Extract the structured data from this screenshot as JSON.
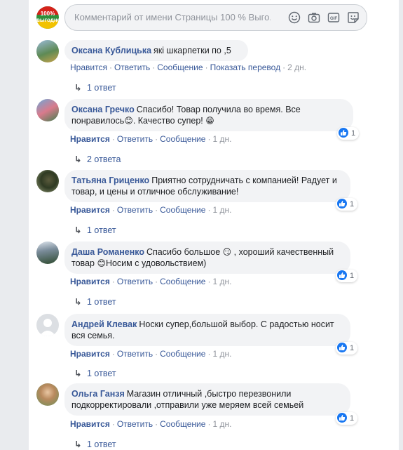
{
  "composer": {
    "placeholder": "Комментарий от имени Страницы 100 % Выго...",
    "page_avatar_text": "100% выгодно",
    "icons": [
      "smile-icon",
      "camera-icon",
      "gif-icon",
      "sticker-icon"
    ]
  },
  "comments": [
    {
      "author": "Оксана Кублицька",
      "text": "які шкарпетки по ,5",
      "actions": {
        "like": "Нравится",
        "reply": "Ответить",
        "message": "Сообщение",
        "translate": "Показать перевод",
        "time": "2 дн."
      },
      "replies": "1 ответ"
    },
    {
      "author": "Оксана Гречко",
      "text": "Спасибо! Товар получила во время. Все понравилось",
      "text_after_emoji": ". Качество супер!",
      "reaction_count": "1",
      "actions": {
        "like": "Нравится",
        "reply": "Ответить",
        "message": "Сообщение",
        "time": "1 дн."
      },
      "replies": "2 ответа"
    },
    {
      "author": "Татьяна Гриценко",
      "text": "Приятно сотрудничать с компанией! Радует и товар, и цены и отличное обслуживание!",
      "reaction_count": "1",
      "actions": {
        "like": "Нравится",
        "reply": "Ответить",
        "message": "Сообщение",
        "time": "1 дн."
      },
      "replies": "1 ответ"
    },
    {
      "author": "Даша Романенко",
      "text": "Спасибо большое",
      "text_mid": ", хороший качественный товар",
      "text_end": "Носим с удовольствием)",
      "reaction_count": "1",
      "actions": {
        "like": "Нравится",
        "reply": "Ответить",
        "message": "Сообщение",
        "time": "1 дн."
      },
      "replies": "1 ответ"
    },
    {
      "author": "Андрей Клевак",
      "text": "Носки супер,большой выбор. С радостью носит вся семья.",
      "reaction_count": "1",
      "actions": {
        "like": "Нравится",
        "reply": "Ответить",
        "message": "Сообщение",
        "time": "1 дн."
      },
      "replies": "1 ответ"
    },
    {
      "author": "Ольга Ганзя",
      "text": "Магазин отличный ,быстро перезвонили подкорректировали ,отправили уже меряем всей семьей",
      "reaction_count": "1",
      "actions": {
        "like": "Нравится",
        "reply": "Ответить",
        "message": "Сообщение",
        "time": "1 дн."
      },
      "replies": "1 ответ"
    }
  ],
  "colors": {
    "link": "#385898",
    "meta": "#90949c",
    "bubble": "#f2f3f5",
    "like": "#1877f2"
  }
}
